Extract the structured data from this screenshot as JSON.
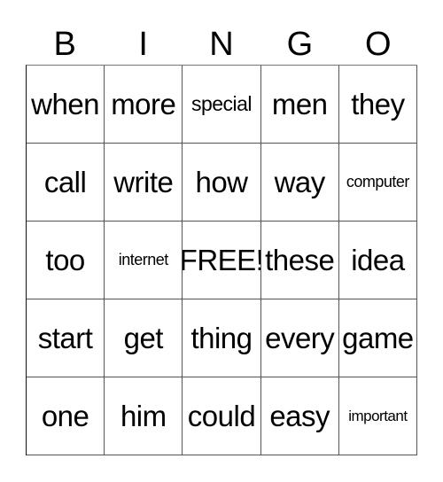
{
  "header": [
    "B",
    "I",
    "N",
    "G",
    "O"
  ],
  "cells": [
    [
      "when",
      "more",
      "special",
      "men",
      "they"
    ],
    [
      "call",
      "write",
      "how",
      "way",
      "computer"
    ],
    [
      "too",
      "internet",
      "FREE!",
      "these",
      "idea"
    ],
    [
      "start",
      "get",
      "thing",
      "every",
      "game"
    ],
    [
      "one",
      "him",
      "could",
      "easy",
      "important"
    ]
  ]
}
